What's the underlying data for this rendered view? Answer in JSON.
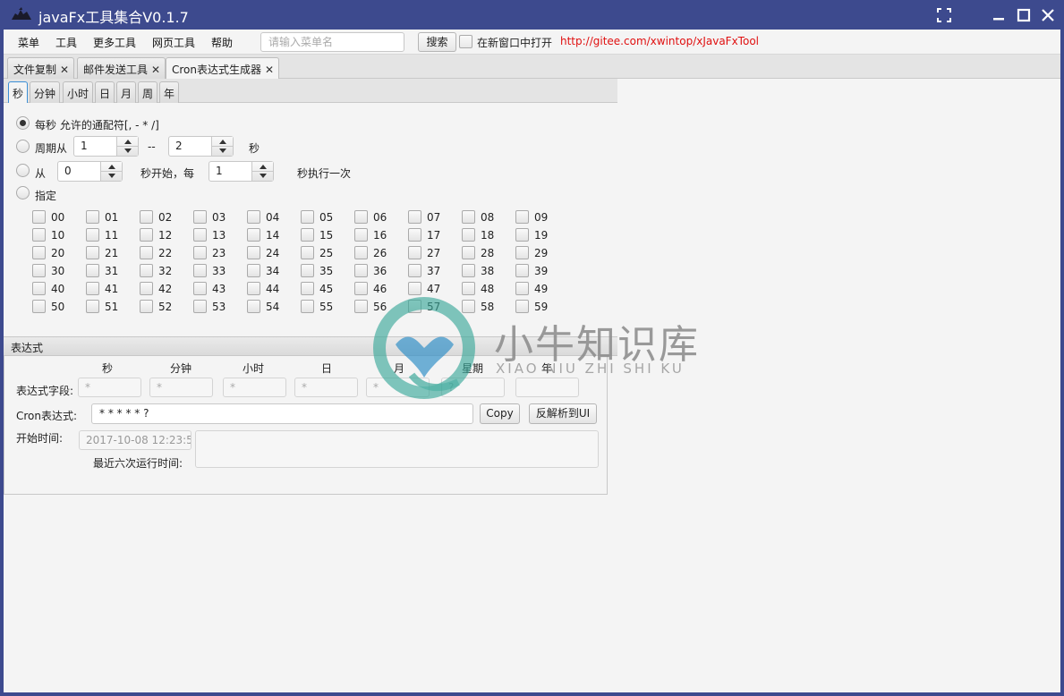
{
  "window": {
    "title": "javaFx工具集合V0.1.7"
  },
  "menubar": {
    "items": [
      "菜单",
      "工具",
      "更多工具",
      "网页工具",
      "帮助"
    ],
    "search_placeholder": "请输入菜单名",
    "search_button": "搜索",
    "new_window_label": "在新窗口中打开",
    "new_window_checked": false,
    "link": "http://gitee.com/xwintop/xJavaFxTool"
  },
  "tabs": [
    {
      "label": "文件复制",
      "active": false
    },
    {
      "label": "邮件发送工具",
      "active": false
    },
    {
      "label": "Cron表达式生成器",
      "active": true
    }
  ],
  "subtabs": [
    {
      "label": "秒",
      "active": true
    },
    {
      "label": "分钟",
      "active": false
    },
    {
      "label": "小时",
      "active": false
    },
    {
      "label": "日",
      "active": false
    },
    {
      "label": "月",
      "active": false
    },
    {
      "label": "周",
      "active": false
    },
    {
      "label": "年",
      "active": false
    }
  ],
  "seconds_panel": {
    "option_every": "每秒 允许的通配符[, - * /]",
    "option_period": "周期从",
    "period_from": "1",
    "period_sep": "--",
    "period_to": "2",
    "period_unit": "秒",
    "option_from": "从",
    "from_start": "0",
    "from_mid": "秒开始，每",
    "from_step": "1",
    "from_end": "秒执行一次",
    "option_specify": "指定",
    "selected_option": "every",
    "checkboxes": [
      "00",
      "01",
      "02",
      "03",
      "04",
      "05",
      "06",
      "07",
      "08",
      "09",
      "10",
      "11",
      "12",
      "13",
      "14",
      "15",
      "16",
      "17",
      "18",
      "19",
      "20",
      "21",
      "22",
      "23",
      "24",
      "25",
      "26",
      "27",
      "28",
      "29",
      "30",
      "31",
      "32",
      "33",
      "34",
      "35",
      "36",
      "37",
      "38",
      "39",
      "40",
      "41",
      "42",
      "43",
      "44",
      "45",
      "46",
      "47",
      "48",
      "49",
      "50",
      "51",
      "52",
      "53",
      "54",
      "55",
      "56",
      "57",
      "58",
      "59"
    ]
  },
  "expression": {
    "section_title": "表达式",
    "columns": [
      "秒",
      "分钟",
      "小时",
      "日",
      "月",
      "星期",
      "年"
    ],
    "fields_label": "表达式字段:",
    "field_values": [
      "*",
      "*",
      "*",
      "*",
      "*",
      "?",
      ""
    ],
    "cron_label": "Cron表达式:",
    "cron_value": "* * * * * ?",
    "copy_button": "Copy",
    "parse_button": "反解析到UI",
    "start_label": "开始时间:",
    "start_value": "2017-10-08 12:23:5",
    "recent_label": "最近六次运行时间:"
  },
  "watermark": {
    "text": "小牛知识库",
    "subtext": "XIAO NIU ZHI SHI KU"
  }
}
